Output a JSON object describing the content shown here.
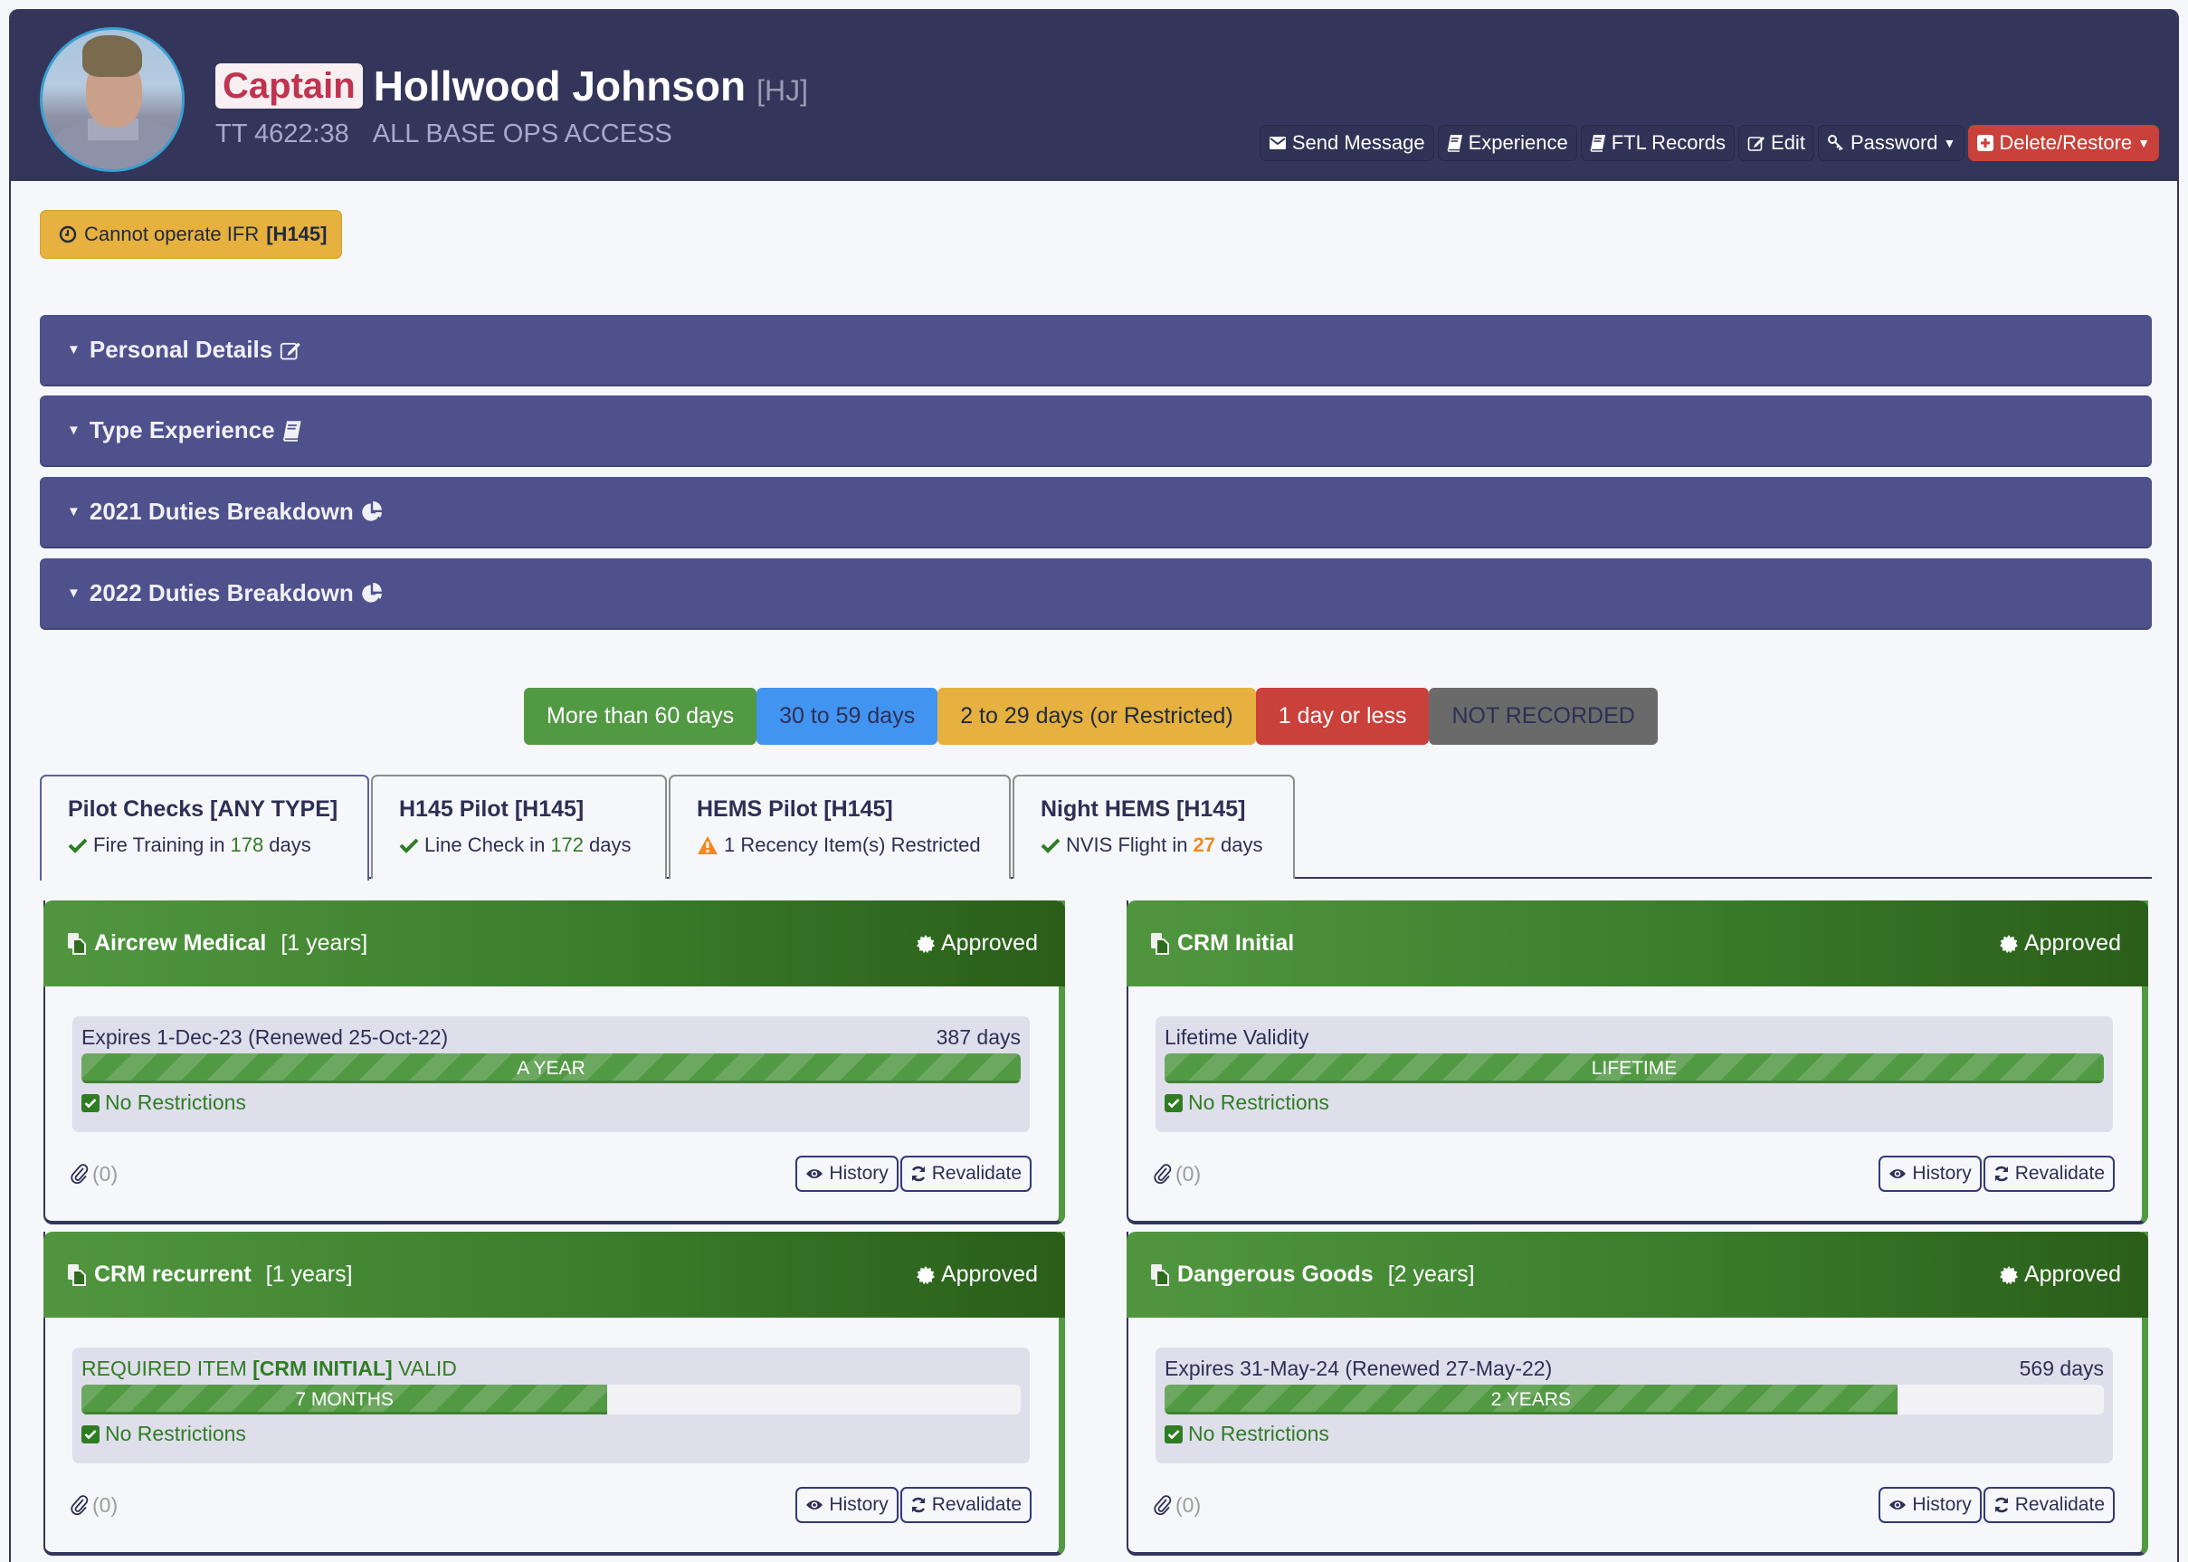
{
  "profile": {
    "rank": "Captain",
    "name": "Hollwood Johnson",
    "initials": "[HJ]",
    "total_time": "TT 4622:38",
    "access": "ALL BASE OPS ACCESS",
    "avatar_icon": "pilot-photo"
  },
  "actions": [
    {
      "label": "Send Message",
      "icon": "envelope-icon"
    },
    {
      "label": "Experience",
      "icon": "book-icon"
    },
    {
      "label": "FTL Records",
      "icon": "book-icon"
    },
    {
      "label": "Edit",
      "icon": "edit-icon"
    },
    {
      "label": "Password",
      "icon": "key-icon",
      "dropdown": true
    },
    {
      "label": "Delete/Restore",
      "icon": "plus-square-icon",
      "dropdown": true
    }
  ],
  "warning": {
    "text": "Cannot operate IFR",
    "tag": "[H145]",
    "icon": "clock-icon"
  },
  "accordions": [
    {
      "label": "Personal Details",
      "icon": "edit-icon"
    },
    {
      "label": "Type Experience",
      "icon": "book-icon"
    },
    {
      "label": "2021 Duties Breakdown",
      "icon": "pie-chart-icon"
    },
    {
      "label": "2022 Duties Breakdown",
      "icon": "pie-chart-icon"
    }
  ],
  "legend": [
    {
      "label": "More than 60 days",
      "bg": "#529944",
      "fg": "#ffffff"
    },
    {
      "label": "30 to 59 days",
      "bg": "#4294f1",
      "fg": "#2d2f55"
    },
    {
      "label": "2 to 29 days (or Restricted)",
      "bg": "#e6b13e",
      "fg": "#1f2a40"
    },
    {
      "label": "1 day or less",
      "bg": "#c9413a",
      "fg": "#ffffff"
    },
    {
      "label": "NOT RECORDED",
      "bg": "#6a6a6a",
      "fg": "#2d2f55"
    }
  ],
  "tabs": [
    {
      "title": "Pilot Checks [ANY TYPE]",
      "status_icon": "check-icon",
      "pre": "Fire Training in",
      "num": "178",
      "post": "days",
      "active": true
    },
    {
      "title": "H145 Pilot [H145]",
      "status_icon": "check-icon",
      "pre": "Line Check in",
      "num": "172",
      "post": "days"
    },
    {
      "title": "HEMS Pilot [H145]",
      "status_icon": "warning-icon",
      "pre": "1 Recency Item(s) Restricted",
      "num": "",
      "post": ""
    },
    {
      "title": "Night HEMS [H145]",
      "status_icon": "check-icon",
      "pre": "NVIS Flight in",
      "num": "27",
      "post": "days"
    }
  ],
  "cards": [
    {
      "title": "Aircrew Medical",
      "period": "[1 years]",
      "status": "Approved",
      "line_left": "Expires 1-Dec-23 (Renewed 25-Oct-22)",
      "line_right": "387 days",
      "bar_label": "A YEAR",
      "bar_fraction": 1.0,
      "restriction": "No Restrictions",
      "attachments": "(0)",
      "history": "History",
      "revalidate": "Revalidate"
    },
    {
      "title": "CRM Initial",
      "period": "",
      "status": "Approved",
      "line_left": "Lifetime Validity",
      "line_right": "",
      "bar_label": "LIFETIME",
      "bar_fraction": 1.0,
      "restriction": "No Restrictions",
      "attachments": "(0)",
      "history": "History",
      "revalidate": "Revalidate"
    },
    {
      "title": "CRM recurrent",
      "period": "[1 years]",
      "status": "Approved",
      "line_left_pre": "REQUIRED ITEM ",
      "line_left_bold": "[CRM INITIAL]",
      "line_left_post": " VALID",
      "line_right": "",
      "bar_label": "7 MONTHS",
      "bar_fraction": 0.56,
      "restriction": "No Restrictions",
      "attachments": "(0)",
      "history": "History",
      "revalidate": "Revalidate"
    },
    {
      "title": "Dangerous Goods",
      "period": "[2 years]",
      "status": "Approved",
      "line_left": "Expires 31-May-24 (Renewed 27-May-22)",
      "line_right": "569 days",
      "bar_label": "2 YEARS",
      "bar_fraction": 0.78,
      "restriction": "No Restrictions",
      "attachments": "(0)",
      "history": "History",
      "revalidate": "Revalidate"
    }
  ]
}
